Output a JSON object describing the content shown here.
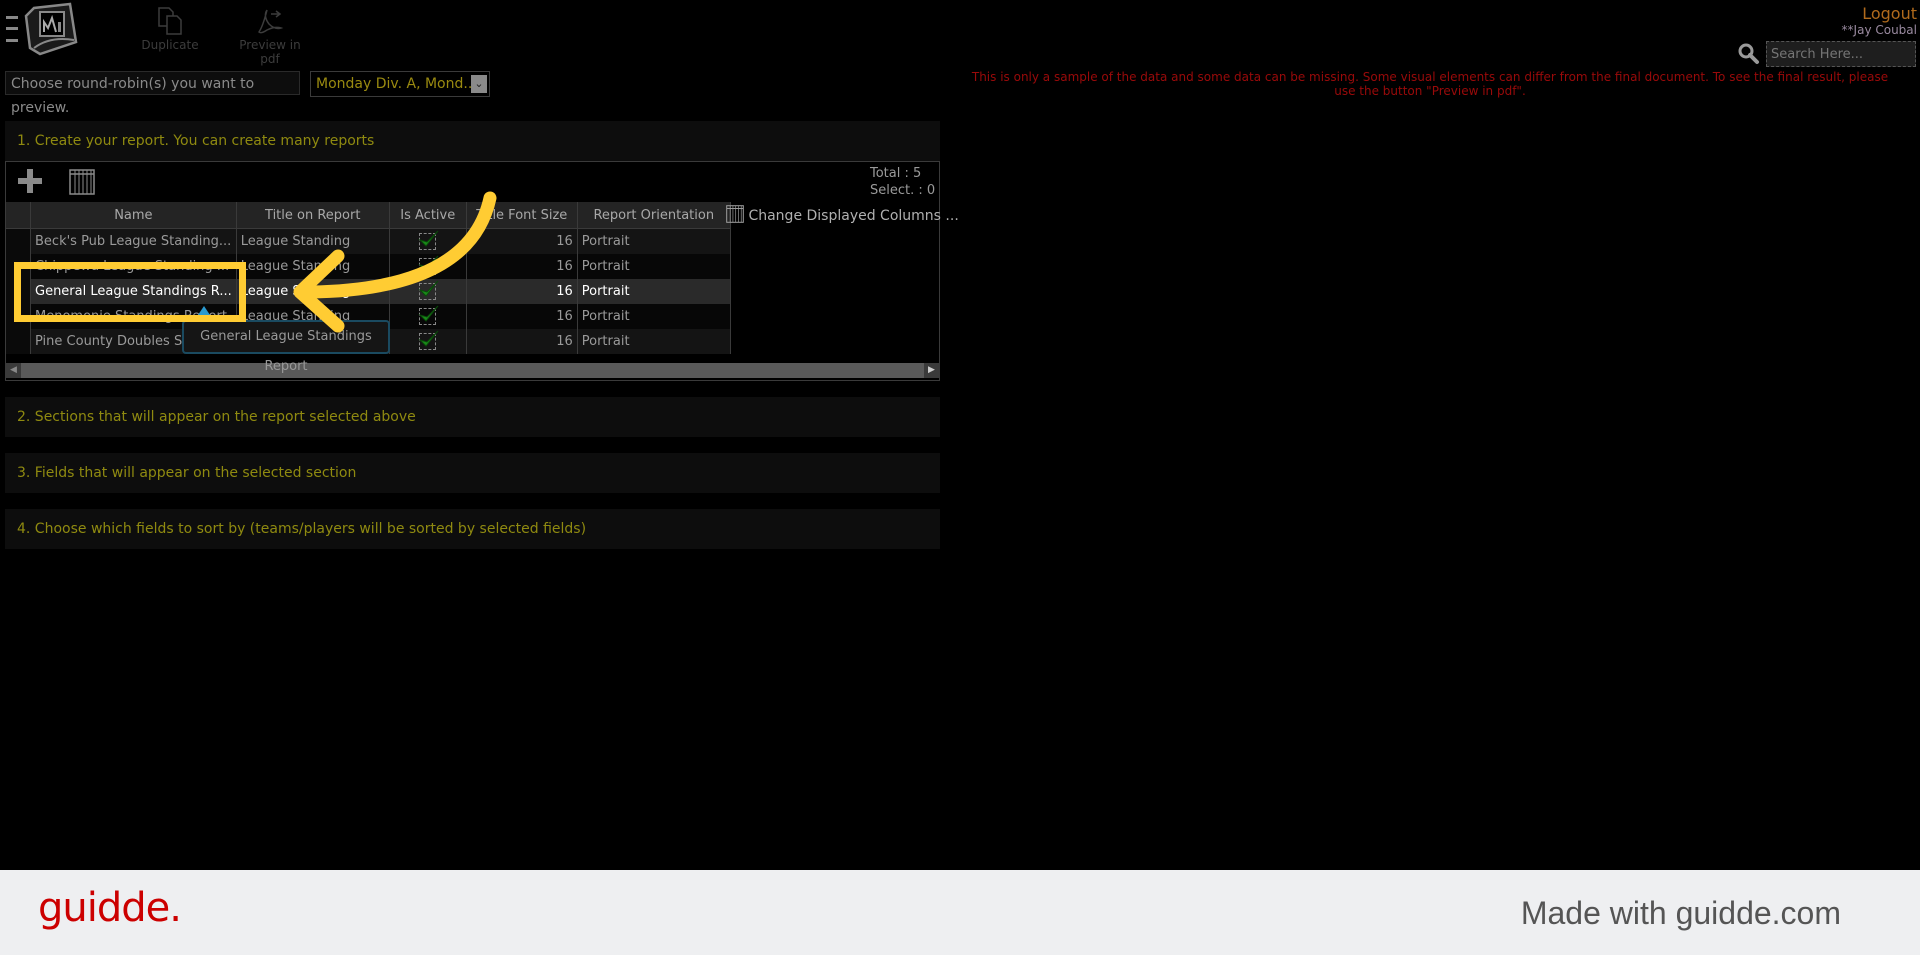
{
  "toolbar": {
    "duplicate_label": "Duplicate",
    "preview_pdf_label": "Preview in pdf"
  },
  "round_robin": {
    "label": "Choose round-robin(s) you want to preview.",
    "selected": "Monday Div. A, Mond..."
  },
  "user": {
    "logout_label": "Logout",
    "name": "**Jay Coubal"
  },
  "search": {
    "placeholder": "Search Here..."
  },
  "notice": "This is only a sample of the data and some data can be missing. Some visual elements can differ from the final document. To see the final result, please use the button \"Preview in pdf\".",
  "sections": [
    {
      "title": "1. Create your report. You can create many reports"
    },
    {
      "title": "2. Sections that will appear on the report selected above"
    },
    {
      "title": "3. Fields that will appear on the selected section"
    },
    {
      "title": "4. Choose which fields to sort by (teams/players will be sorted by selected fields)"
    }
  ],
  "grid": {
    "total_label": "Total : 5",
    "selected_label": "Select. : 0",
    "change_columns_label": "Change Displayed Columns ...",
    "columns": [
      "Name",
      "Title on Report",
      "Is Active",
      "Title Font Size",
      "Report Orientation"
    ],
    "rows": [
      {
        "name": "Beck's Pub League Standing...",
        "title": "League Standing",
        "active": true,
        "font_size": "16",
        "orientation": "Portrait"
      },
      {
        "name": "Chippewa League Standing ...",
        "title": "League Standing",
        "active": true,
        "font_size": "16",
        "orientation": "Portrait"
      },
      {
        "name": "General League Standings R...",
        "title": "League Standing",
        "active": true,
        "font_size": "16",
        "orientation": "Portrait"
      },
      {
        "name": "Menomonie Standings Report",
        "title": "League Standing",
        "active": true,
        "font_size": "16",
        "orientation": "Portrait"
      },
      {
        "name": "Pine County Doubles St...",
        "title": "League Standing",
        "active": true,
        "font_size": "16",
        "orientation": "Portrait"
      }
    ],
    "selected_row": 2
  },
  "tooltip": "General League Standings Report",
  "footer": {
    "logo": "guidde.",
    "made_with": "Made with guidde.com"
  },
  "colors": {
    "section_title": "#8f8a10",
    "logout": "#b06a1c",
    "notice": "#9a0a0a",
    "annotation": "#ffcc33",
    "check": "#1a8a1a",
    "guidde_red": "#cc0000"
  }
}
